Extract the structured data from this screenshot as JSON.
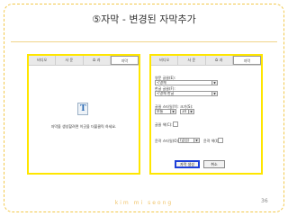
{
  "slide": {
    "title": "⑤자막 - 변경된 자막추가",
    "author": "kim mi seong",
    "page_number": "36"
  },
  "colors": {
    "highlight_border": "#ffe600",
    "frame_border": "#f2c84b",
    "primary_button_border": "#1e40d8"
  },
  "left_panel": {
    "tabs": [
      {
        "label": "비디오"
      },
      {
        "label": "사 운"
      },
      {
        "label": "효 과"
      },
      {
        "label": "자막",
        "active": true
      }
    ],
    "icon": "subtitle-doc-icon",
    "hint": "자막을 생성할려면 이곳을 더블클릭 하세요."
  },
  "right_panel": {
    "tabs": [
      {
        "label": "비디오"
      },
      {
        "label": "사 운"
      },
      {
        "label": "효 과"
      },
      {
        "label": "자막",
        "active": true
      }
    ],
    "english_font_label": "영문 글꼴(E):",
    "english_font_value": "<명체",
    "korean_font_label": "한글 글꼴(F):",
    "korean_font_value": "<명체 한글",
    "style_label": "글꼴 스타일(Y):",
    "style_value": "보통",
    "size_label": "크기(S):",
    "size_value": "34",
    "color_label": "글꼴 색(C):",
    "outline_style_label": "윤곽 스타일(O):",
    "outline_style_value": "(없음)",
    "outline_color_label": "윤곽 색(I):",
    "apply_button": "자막 생성",
    "cancel_button": "취소"
  }
}
